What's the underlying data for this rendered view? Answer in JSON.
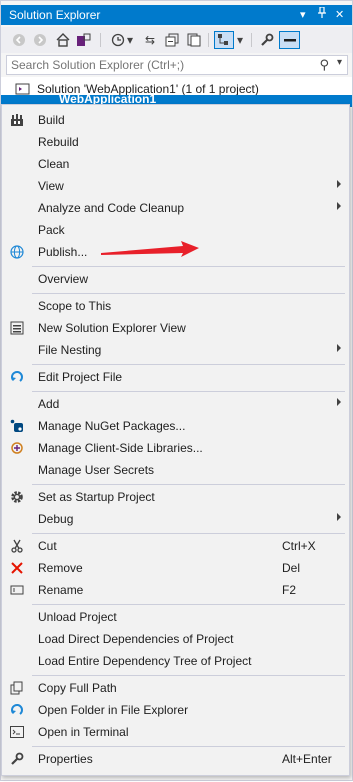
{
  "window": {
    "title": "Solution Explorer"
  },
  "search": {
    "placeholder": "Search Solution Explorer (Ctrl+;)"
  },
  "tree": {
    "solution_label": "Solution 'WebApplication1' (1 of 1 project)",
    "project_label": "WebApplication1"
  },
  "colors": {
    "accent": "#007acc",
    "arrow": "#e8202a",
    "menu_bg": "#f2f2f2"
  },
  "menu": {
    "items": [
      {
        "label": "Build",
        "icon": "build-icon"
      },
      {
        "label": "Rebuild"
      },
      {
        "label": "Clean"
      },
      {
        "label": "View",
        "submenu": true
      },
      {
        "label": "Analyze and Code Cleanup",
        "submenu": true
      },
      {
        "label": "Pack"
      },
      {
        "label": "Publish...",
        "icon": "globe-icon"
      },
      {
        "label": "Overview"
      },
      {
        "label": "Scope to This"
      },
      {
        "label": "New Solution Explorer View",
        "icon": "new-view-icon"
      },
      {
        "label": "File Nesting",
        "submenu": true
      },
      {
        "label": "Edit Project File",
        "icon": "edit-arrow-icon"
      },
      {
        "label": "Add",
        "submenu": true
      },
      {
        "label": "Manage NuGet Packages...",
        "icon": "nuget-icon"
      },
      {
        "label": "Manage Client-Side Libraries...",
        "icon": "libraries-icon"
      },
      {
        "label": "Manage User Secrets"
      },
      {
        "label": "Set as Startup Project",
        "icon": "gear-icon"
      },
      {
        "label": "Debug",
        "submenu": true
      },
      {
        "label": "Cut",
        "icon": "scissors-icon",
        "shortcut": "Ctrl+X"
      },
      {
        "label": "Remove",
        "icon": "red-x-icon",
        "shortcut": "Del"
      },
      {
        "label": "Rename",
        "icon": "rename-icon",
        "shortcut": "F2"
      },
      {
        "label": "Unload Project"
      },
      {
        "label": "Load Direct Dependencies of Project"
      },
      {
        "label": "Load Entire Dependency Tree of Project"
      },
      {
        "label": "Copy Full Path",
        "icon": "copy-icon"
      },
      {
        "label": "Open Folder in File Explorer",
        "icon": "open-folder-arrow-icon"
      },
      {
        "label": "Open in Terminal",
        "icon": "terminal-icon"
      },
      {
        "label": "Properties",
        "icon": "wrench-icon",
        "shortcut": "Alt+Enter"
      }
    ]
  }
}
